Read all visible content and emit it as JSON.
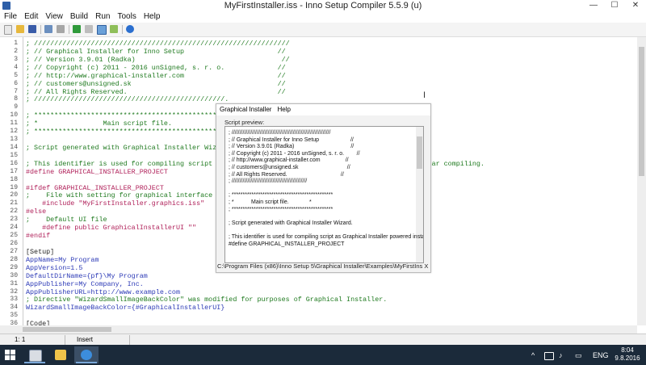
{
  "window": {
    "title": "MyFirstInstaller.iss - Inno Setup Compiler 5.5.9 (u)",
    "min": "—",
    "max": "☐",
    "close": "✕"
  },
  "menu": [
    "File",
    "Edit",
    "View",
    "Build",
    "Run",
    "Tools",
    "Help"
  ],
  "toolbar_icons": [
    "new-file-icon",
    "open-folder-icon",
    "save-icon",
    "compile-icon",
    "stop-compile-icon",
    "run-icon",
    "pause-icon",
    "graphical-installer-icon",
    "wizard-icon",
    "help-icon"
  ],
  "editor": {
    "line_numbers": [
      "1",
      "2",
      "3",
      "4",
      "5",
      "6",
      "7",
      "8",
      "9",
      "10",
      "11",
      "12",
      "13",
      "14",
      "15",
      "16",
      "17",
      "18",
      "19",
      "20",
      "21",
      "22",
      "23",
      "24",
      "25",
      "26",
      "27",
      "28",
      "29",
      "30",
      "31",
      "32",
      "33",
      "34",
      "35",
      "36"
    ],
    "lines": [
      {
        "text": "; ///////////////////////////////////////////////////////////////",
        "cls": "c-cmt"
      },
      {
        "text": "; // Graphical Installer for Inno Setup                       //",
        "cls": "c-cmt"
      },
      {
        "text": "; // Version 3.9.01 (Radka)                                    //",
        "cls": "c-cmt"
      },
      {
        "text": "; // Copyright (c) 2011 - 2016 unSigned, s. r. o.             //",
        "cls": "c-cmt"
      },
      {
        "text": "; // http://www.graphical-installer.com                       //",
        "cls": "c-cmt"
      },
      {
        "text": "; // customers@unsigned.sk                                    //",
        "cls": "c-cmt"
      },
      {
        "text": "; // All Rights Reserved.                                     //",
        "cls": "c-cmt"
      },
      {
        "text": "; ///////////////////////////////////////////////.",
        "cls": "c-cmt"
      },
      {
        "text": "",
        "cls": "c-cmt"
      },
      {
        "text": "; ****************************************************",
        "cls": "c-cmt"
      },
      {
        "text": "; *                Main script file.              *",
        "cls": "c-cmt"
      },
      {
        "text": "; ****************************************************",
        "cls": "c-cmt"
      },
      {
        "text": "",
        "cls": "c-cmt"
      },
      {
        "text": "; Script generated with Graphical Installer Wiz",
        "cls": "c-cmt"
      },
      {
        "text": "",
        "cls": "c-cmt"
      },
      {
        "text": "; This identifier is used for compiling script                                          ut for regular compiling.",
        "cls": "c-cmt"
      },
      {
        "text": "#define GRAPHICAL_INSTALLER_PROJECT",
        "cls": "c-dir"
      },
      {
        "text": "",
        "cls": "c-cmt"
      },
      {
        "text": "#ifdef GRAPHICAL_INSTALLER_PROJECT",
        "cls": "c-dir"
      },
      {
        "text": ";    File with setting for graphical interface",
        "cls": "c-cmt"
      },
      {
        "text": "    #include \"MyFirstInstaller.graphics.iss\"",
        "cls": "c-dir"
      },
      {
        "text": "#else",
        "cls": "c-dir"
      },
      {
        "text": ";    Default UI file",
        "cls": "c-cmt"
      },
      {
        "text": "    #define public GraphicalInstallerUI \"\"",
        "cls": "c-dir"
      },
      {
        "text": "#endif",
        "cls": "c-dir"
      },
      {
        "text": "",
        "cls": "c-cmt"
      },
      {
        "text": "[Setup]",
        "cls": "c-sec"
      },
      {
        "text": "AppName=My Program",
        "cls": "c-key"
      },
      {
        "text": "AppVersion=1.5",
        "cls": "c-key"
      },
      {
        "text": "DefaultDirName={pf}\\My Program",
        "cls": "c-key"
      },
      {
        "text": "AppPublisher=My Company, Inc.",
        "cls": "c-key"
      },
      {
        "text": "AppPublisherURL=http://www.example.com",
        "cls": "c-key"
      },
      {
        "text": "; Directive \"WizardSmallImageBackColor\" was modified for purposes of Graphical Installer.",
        "cls": "c-cmt"
      },
      {
        "text": "WizardSmallImageBackColor={#GraphicalInstallerUI}",
        "cls": "c-key"
      },
      {
        "text": "",
        "cls": "c-cmt"
      },
      {
        "text": "[Code]",
        "cls": "c-sec"
      }
    ]
  },
  "popup": {
    "menu": [
      "Graphical Installer",
      "Help"
    ],
    "preview_label": "Script preview:",
    "preview_lines": [
      "; ///////////////////////////////////////////////////////////////",
      "; // Graphical Installer for Inno Setup                    //",
      "; // Version 3.9.01 (Radka)                                    //",
      "; // Copyright (c) 2011 - 2016 unSigned, s. r. o.        //",
      "; // http://www.graphical-installer.com                //",
      "; // customers@unsigned.sk                               //",
      "; // All Rights Reserved.                                  //",
      "; ////////////////////////////////////////////////",
      "",
      "; **********************************************",
      "; *           Main script file.             *",
      "; **********************************************",
      "",
      "; Script generated with Graphical Installer Wizard.",
      "",
      "; This identifier is used for compiling script as Graphical Installer powered installe",
      "#define GRAPHICAL_INSTALLER_PROJECT"
    ],
    "path": "C:\\Program Files (x86)\\Inno Setup 5\\Graphical Installer\\Examples\\MyFirstIns X"
  },
  "status": {
    "position": "1:  1",
    "mode": "Insert"
  },
  "taskbar": {
    "apps": [
      "inno-setup-app",
      "file-explorer-app",
      "internet-explorer-app"
    ],
    "tray": {
      "chevron": "^",
      "language": "ENG",
      "time": "8:04",
      "date": "9.8.2016"
    }
  },
  "colors": {
    "comment": "#1f7a1f",
    "directive": "#b0215a",
    "key": "#2b39b6",
    "taskbar": "#1b2a3a"
  }
}
